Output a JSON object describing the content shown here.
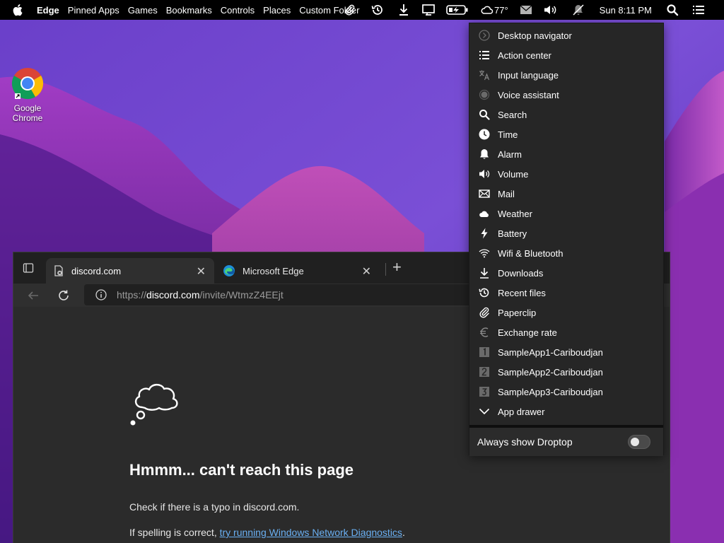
{
  "menubar": {
    "active_app": "Edge",
    "items": [
      "Pinned Apps",
      "Games",
      "Bookmarks",
      "Controls",
      "Places",
      "Custom Folder"
    ],
    "weather_temp": "77°",
    "clock": "Sun 8:11 PM"
  },
  "desktop": {
    "icons": [
      {
        "label": "Google Chrome"
      }
    ]
  },
  "browser": {
    "tabs": [
      {
        "title": "discord.com",
        "active": true
      },
      {
        "title": "Microsoft Edge",
        "active": false
      }
    ],
    "address": {
      "scheme": "https://",
      "host": "discord.com",
      "path": "/invite/WtmzZ4EEjt"
    },
    "error": {
      "title": "Hmmm... can't reach this page",
      "line1": "Check if there is a typo in discord.com.",
      "line2_prefix": "If spelling is correct, ",
      "line2_link": "try running Windows Network Diagnostics",
      "line2_suffix": "."
    }
  },
  "dropdown": {
    "items": [
      {
        "label": "Desktop navigator",
        "icon": "chevron-circle-icon"
      },
      {
        "label": "Action center",
        "icon": "list-icon"
      },
      {
        "label": "Input language",
        "icon": "translate-icon"
      },
      {
        "label": "Voice assistant",
        "icon": "voice-dot-icon"
      },
      {
        "label": "Search",
        "icon": "search-icon"
      },
      {
        "label": "Time",
        "icon": "clock-icon"
      },
      {
        "label": "Alarm",
        "icon": "bell-icon"
      },
      {
        "label": "Volume",
        "icon": "speaker-icon"
      },
      {
        "label": "Mail",
        "icon": "mail-icon"
      },
      {
        "label": "Weather",
        "icon": "cloud-icon"
      },
      {
        "label": "Battery",
        "icon": "bolt-icon"
      },
      {
        "label": "Wifi & Bluetooth",
        "icon": "wifi-icon"
      },
      {
        "label": "Downloads",
        "icon": "download-icon"
      },
      {
        "label": "Recent files",
        "icon": "history-icon"
      },
      {
        "label": "Paperclip",
        "icon": "paperclip-icon"
      },
      {
        "label": "Exchange rate",
        "icon": "euro-icon"
      },
      {
        "label": "SampleApp1-Cariboudjan",
        "icon": "number-1-icon"
      },
      {
        "label": "SampleApp2-Cariboudjan",
        "icon": "number-2-icon"
      },
      {
        "label": "SampleApp3-Cariboudjan",
        "icon": "number-3-icon"
      },
      {
        "label": "App drawer",
        "icon": "chevron-down-icon"
      }
    ],
    "footer_label": "Always show Droptop",
    "toggle_on": false
  },
  "colors": {
    "menubar_bg": "#000000",
    "panel_bg": "#262626",
    "link": "#6ab0f3"
  }
}
